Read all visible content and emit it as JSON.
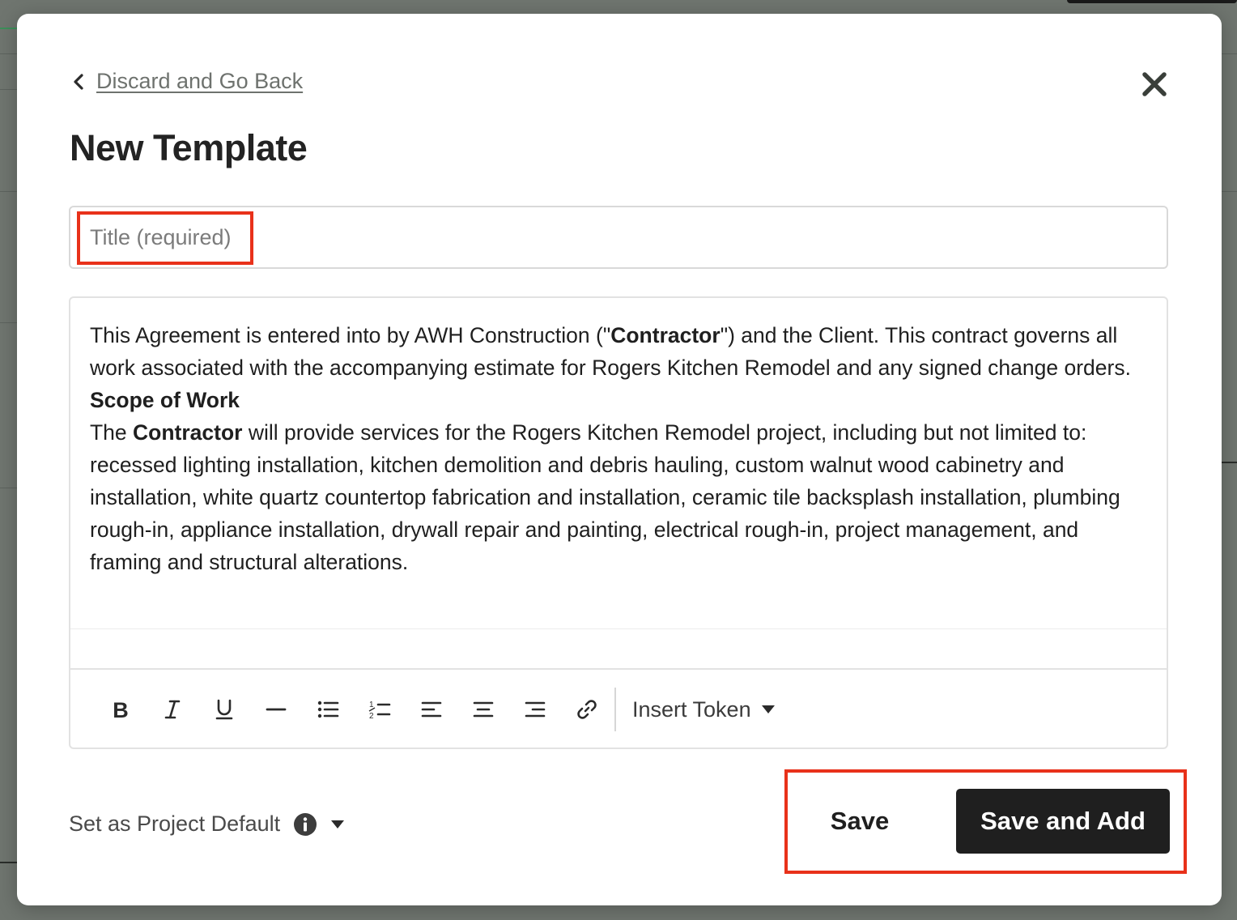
{
  "modal": {
    "back_link": "Discard and Go Back",
    "title": "New Template",
    "title_input": {
      "placeholder": "Title (required)",
      "value": ""
    },
    "editor": {
      "p1_part1": "This Agreement is entered into by AWH Construction (\"",
      "p1_bold": "Contractor",
      "p1_part2": "\") and the Client. This contract governs all work associated with the accompanying estimate for Rogers Kitchen Remodel and any signed change orders.",
      "heading": "Scope of Work",
      "p2_part1": "The ",
      "p2_bold": "Contractor",
      "p2_part2": " will provide services for the Rogers Kitchen Remodel project, including but not limited to: recessed lighting installation, kitchen demolition and debris hauling, custom walnut wood cabinetry and installation, white quartz countertop fabrication and installation, ceramic tile backsplash installation, plumbing rough-in, appliance installation, drywall repair and painting, electrical rough-in, project management, and framing and structural alterations."
    },
    "toolbar": {
      "buttons": [
        "bold-icon",
        "italic-icon",
        "underline-icon",
        "horizontal-rule-icon",
        "bullet-list-icon",
        "numbered-list-icon",
        "align-left-icon",
        "align-center-icon",
        "align-right-icon",
        "link-icon"
      ],
      "insert_token": "Insert Token"
    },
    "footer": {
      "default_label": "Set as Project Default",
      "save": "Save",
      "save_and_add": "Save and Add"
    }
  },
  "colors": {
    "primary_button": "#1f1f1f",
    "highlight": "#e8311a",
    "overlay": "#6f756f"
  }
}
